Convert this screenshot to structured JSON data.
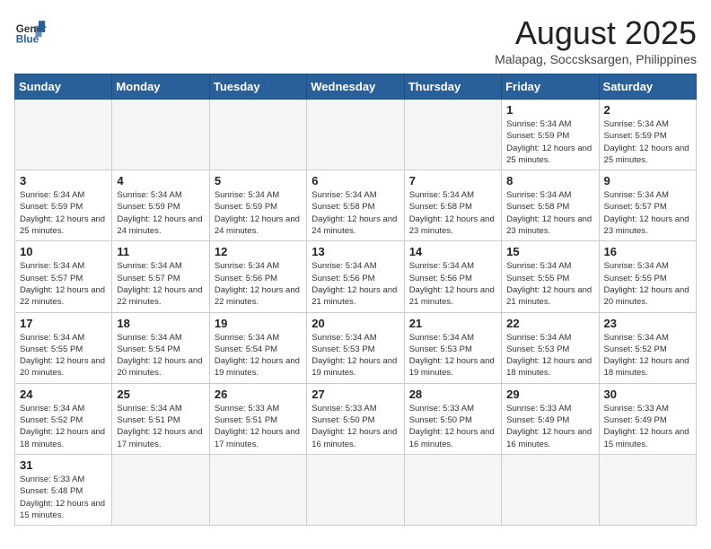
{
  "header": {
    "logo_general": "General",
    "logo_blue": "Blue",
    "month_title": "August 2025",
    "location": "Malapag, Soccsksargen, Philippines"
  },
  "weekdays": [
    "Sunday",
    "Monday",
    "Tuesday",
    "Wednesday",
    "Thursday",
    "Friday",
    "Saturday"
  ],
  "weeks": [
    [
      {
        "day": "",
        "info": ""
      },
      {
        "day": "",
        "info": ""
      },
      {
        "day": "",
        "info": ""
      },
      {
        "day": "",
        "info": ""
      },
      {
        "day": "",
        "info": ""
      },
      {
        "day": "1",
        "info": "Sunrise: 5:34 AM\nSunset: 5:59 PM\nDaylight: 12 hours and 25 minutes."
      },
      {
        "day": "2",
        "info": "Sunrise: 5:34 AM\nSunset: 5:59 PM\nDaylight: 12 hours and 25 minutes."
      }
    ],
    [
      {
        "day": "3",
        "info": "Sunrise: 5:34 AM\nSunset: 5:59 PM\nDaylight: 12 hours and 25 minutes."
      },
      {
        "day": "4",
        "info": "Sunrise: 5:34 AM\nSunset: 5:59 PM\nDaylight: 12 hours and 24 minutes."
      },
      {
        "day": "5",
        "info": "Sunrise: 5:34 AM\nSunset: 5:59 PM\nDaylight: 12 hours and 24 minutes."
      },
      {
        "day": "6",
        "info": "Sunrise: 5:34 AM\nSunset: 5:58 PM\nDaylight: 12 hours and 24 minutes."
      },
      {
        "day": "7",
        "info": "Sunrise: 5:34 AM\nSunset: 5:58 PM\nDaylight: 12 hours and 23 minutes."
      },
      {
        "day": "8",
        "info": "Sunrise: 5:34 AM\nSunset: 5:58 PM\nDaylight: 12 hours and 23 minutes."
      },
      {
        "day": "9",
        "info": "Sunrise: 5:34 AM\nSunset: 5:57 PM\nDaylight: 12 hours and 23 minutes."
      }
    ],
    [
      {
        "day": "10",
        "info": "Sunrise: 5:34 AM\nSunset: 5:57 PM\nDaylight: 12 hours and 22 minutes."
      },
      {
        "day": "11",
        "info": "Sunrise: 5:34 AM\nSunset: 5:57 PM\nDaylight: 12 hours and 22 minutes."
      },
      {
        "day": "12",
        "info": "Sunrise: 5:34 AM\nSunset: 5:56 PM\nDaylight: 12 hours and 22 minutes."
      },
      {
        "day": "13",
        "info": "Sunrise: 5:34 AM\nSunset: 5:56 PM\nDaylight: 12 hours and 21 minutes."
      },
      {
        "day": "14",
        "info": "Sunrise: 5:34 AM\nSunset: 5:56 PM\nDaylight: 12 hours and 21 minutes."
      },
      {
        "day": "15",
        "info": "Sunrise: 5:34 AM\nSunset: 5:55 PM\nDaylight: 12 hours and 21 minutes."
      },
      {
        "day": "16",
        "info": "Sunrise: 5:34 AM\nSunset: 5:55 PM\nDaylight: 12 hours and 20 minutes."
      }
    ],
    [
      {
        "day": "17",
        "info": "Sunrise: 5:34 AM\nSunset: 5:55 PM\nDaylight: 12 hours and 20 minutes."
      },
      {
        "day": "18",
        "info": "Sunrise: 5:34 AM\nSunset: 5:54 PM\nDaylight: 12 hours and 20 minutes."
      },
      {
        "day": "19",
        "info": "Sunrise: 5:34 AM\nSunset: 5:54 PM\nDaylight: 12 hours and 19 minutes."
      },
      {
        "day": "20",
        "info": "Sunrise: 5:34 AM\nSunset: 5:53 PM\nDaylight: 12 hours and 19 minutes."
      },
      {
        "day": "21",
        "info": "Sunrise: 5:34 AM\nSunset: 5:53 PM\nDaylight: 12 hours and 19 minutes."
      },
      {
        "day": "22",
        "info": "Sunrise: 5:34 AM\nSunset: 5:53 PM\nDaylight: 12 hours and 18 minutes."
      },
      {
        "day": "23",
        "info": "Sunrise: 5:34 AM\nSunset: 5:52 PM\nDaylight: 12 hours and 18 minutes."
      }
    ],
    [
      {
        "day": "24",
        "info": "Sunrise: 5:34 AM\nSunset: 5:52 PM\nDaylight: 12 hours and 18 minutes."
      },
      {
        "day": "25",
        "info": "Sunrise: 5:34 AM\nSunset: 5:51 PM\nDaylight: 12 hours and 17 minutes."
      },
      {
        "day": "26",
        "info": "Sunrise: 5:33 AM\nSunset: 5:51 PM\nDaylight: 12 hours and 17 minutes."
      },
      {
        "day": "27",
        "info": "Sunrise: 5:33 AM\nSunset: 5:50 PM\nDaylight: 12 hours and 16 minutes."
      },
      {
        "day": "28",
        "info": "Sunrise: 5:33 AM\nSunset: 5:50 PM\nDaylight: 12 hours and 16 minutes."
      },
      {
        "day": "29",
        "info": "Sunrise: 5:33 AM\nSunset: 5:49 PM\nDaylight: 12 hours and 16 minutes."
      },
      {
        "day": "30",
        "info": "Sunrise: 5:33 AM\nSunset: 5:49 PM\nDaylight: 12 hours and 15 minutes."
      }
    ],
    [
      {
        "day": "31",
        "info": "Sunrise: 5:33 AM\nSunset: 5:48 PM\nDaylight: 12 hours and 15 minutes."
      },
      {
        "day": "",
        "info": ""
      },
      {
        "day": "",
        "info": ""
      },
      {
        "day": "",
        "info": ""
      },
      {
        "day": "",
        "info": ""
      },
      {
        "day": "",
        "info": ""
      },
      {
        "day": "",
        "info": ""
      }
    ]
  ]
}
